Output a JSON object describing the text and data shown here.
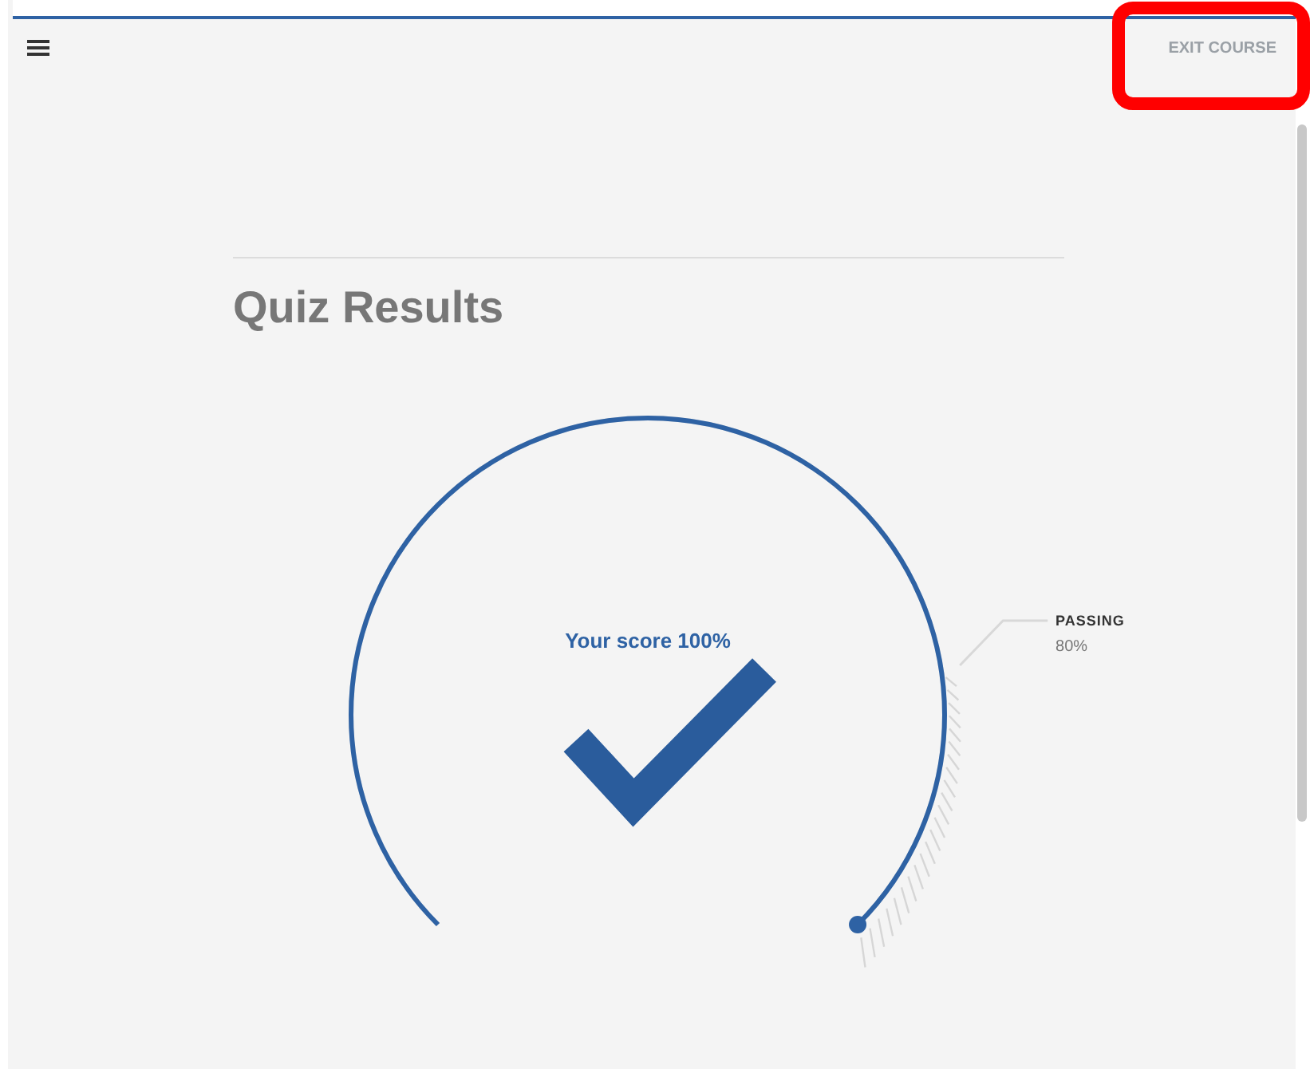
{
  "header": {
    "exit_label": "EXIT COURSE",
    "highlighted": true
  },
  "title": "Quiz Results",
  "score": {
    "label": "Your score 100%",
    "level": 1.0,
    "passed": true
  },
  "passing": {
    "label": "PASSING",
    "value": "80%",
    "level": 0.8
  }
}
